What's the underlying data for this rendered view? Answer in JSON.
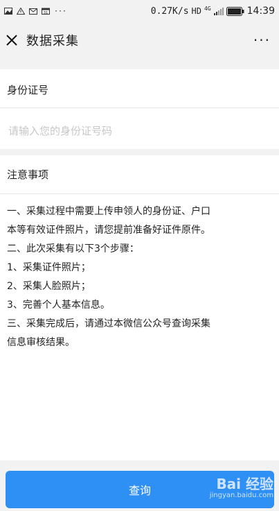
{
  "status_bar": {
    "network_speed": "0.27K/s",
    "hd_label": "HD",
    "network_type": "4G",
    "more_dots": "···",
    "time": "14:39"
  },
  "header": {
    "title": "数据采集",
    "more_label": "···"
  },
  "id_section": {
    "label": "身份证号",
    "placeholder": "请输入您的身份证号码",
    "value": ""
  },
  "notes": {
    "title": "注意事项",
    "lines": [
      "一、采集过程中需要上传申领人的身份证、户口",
      "本等有效证件照片，请您提前准备好证件原件。",
      "二、此次采集有以下3个步骤：",
      "1、采集证件照片；",
      "2、采集人脸照片；",
      "3、完善个人基本信息。",
      "三、采集完成后，请通过本微信公众号查询采集",
      "信息审核结果。"
    ]
  },
  "footer": {
    "query_label": "查询"
  },
  "watermark": {
    "logo": "Bai 经验",
    "url": "jingyan.baidu.com"
  },
  "colors": {
    "primary": "#2e8ff5",
    "background": "#f2f2f2",
    "placeholder": "#c7c7c7"
  }
}
